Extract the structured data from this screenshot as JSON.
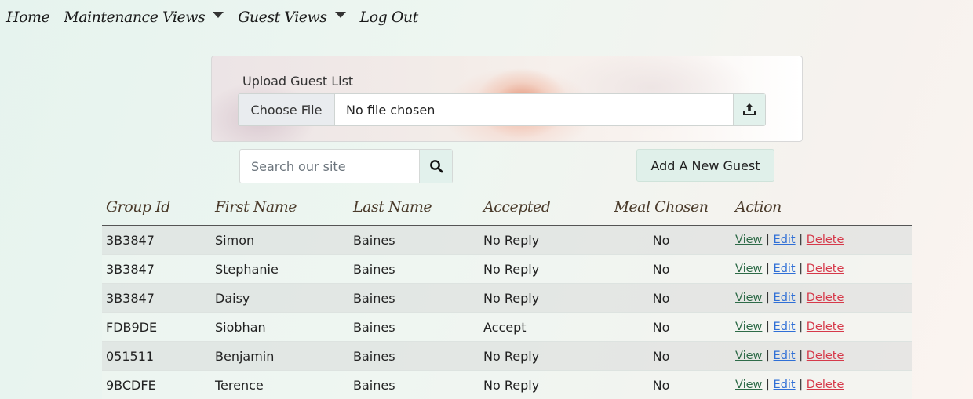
{
  "nav": {
    "home": "Home",
    "maintenance": "Maintenance Views",
    "guest": "Guest Views",
    "logout": "Log Out"
  },
  "upload": {
    "label": "Upload Guest List",
    "choose_label": "Choose File",
    "status": "No file chosen",
    "upload_icon": "upload-icon"
  },
  "search": {
    "placeholder": "Search our site",
    "value": "",
    "icon": "search-icon"
  },
  "add_button": "Add A New Guest",
  "table": {
    "headers": [
      "Group Id",
      "First Name",
      "Last Name",
      "Accepted",
      "Meal Chosen",
      "Action"
    ],
    "rows": [
      {
        "group_id": "3B3847",
        "first": "Simon",
        "last": "Baines",
        "accepted": "No Reply",
        "meal": "No"
      },
      {
        "group_id": "3B3847",
        "first": "Stephanie",
        "last": "Baines",
        "accepted": "No Reply",
        "meal": "No"
      },
      {
        "group_id": "3B3847",
        "first": "Daisy",
        "last": "Baines",
        "accepted": "No Reply",
        "meal": "No"
      },
      {
        "group_id": "FDB9DE",
        "first": "Siobhan",
        "last": "Baines",
        "accepted": "Accept",
        "meal": "No"
      },
      {
        "group_id": "051511",
        "first": "Benjamin",
        "last": "Baines",
        "accepted": "No Reply",
        "meal": "No"
      },
      {
        "group_id": "9BCDFE",
        "first": "Terence",
        "last": "Baines",
        "accepted": "No Reply",
        "meal": "No"
      }
    ],
    "actions": {
      "view": "View",
      "sep": "|",
      "edit": "Edit",
      "delete": "Delete"
    }
  },
  "colors": {
    "accent": "#e0f0ea",
    "view_link": "#2e6b48",
    "edit_link": "#2f6fd6",
    "delete_link": "#d6394a"
  }
}
